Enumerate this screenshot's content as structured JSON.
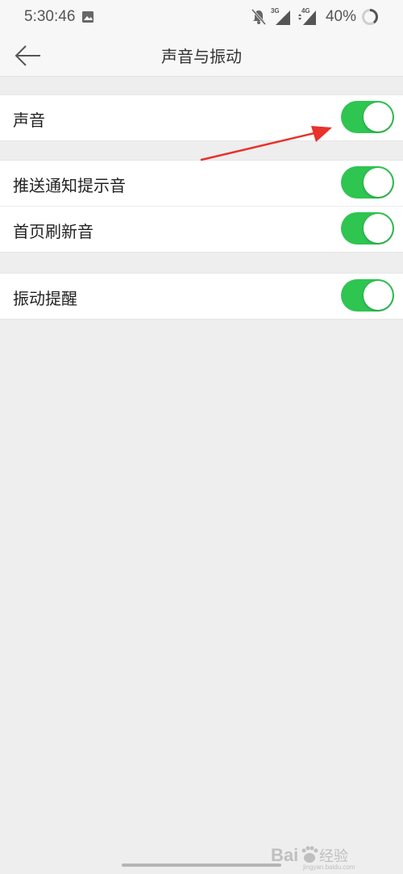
{
  "status_bar": {
    "time": "5:30:46",
    "net1": "3G",
    "net2": "4G",
    "battery": "40%",
    "battery_level": 0.4,
    "icons": [
      "gallery-icon",
      "bell-off-icon",
      "signal-icon",
      "signal-icon",
      "battery-ring-icon"
    ]
  },
  "header": {
    "title": "声音与振动",
    "back_icon": "arrow-left-icon"
  },
  "groups": [
    {
      "rows": [
        {
          "label": "声音",
          "on": true
        }
      ]
    },
    {
      "rows": [
        {
          "label": "推送通知提示音",
          "on": true
        },
        {
          "label": "首页刷新音",
          "on": true
        }
      ]
    },
    {
      "rows": [
        {
          "label": "振动提醒",
          "on": true
        }
      ]
    }
  ],
  "colors": {
    "toggle_on": "#2ec551",
    "background": "#eeeeee",
    "annotation": "#e8322b"
  },
  "watermark": {
    "brand": "Bai",
    "suffix": "经验",
    "url": "jingyan.baidu.com"
  }
}
